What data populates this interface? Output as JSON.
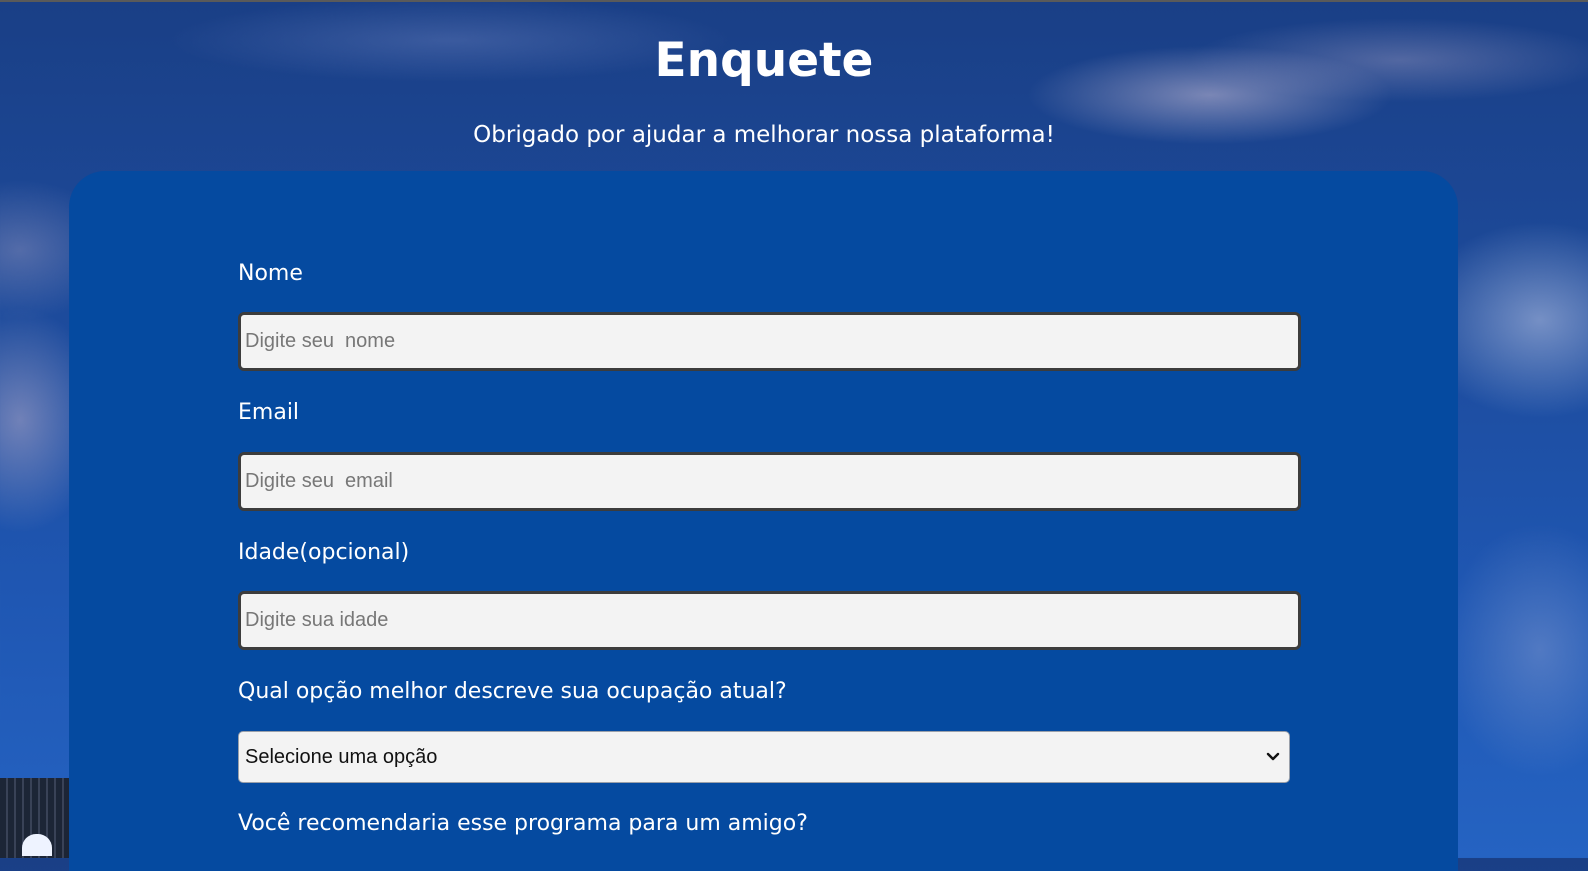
{
  "header": {
    "title": "Enquete",
    "subtitle": "Obrigado por ajudar a melhorar nossa plataforma!"
  },
  "form": {
    "name": {
      "label": "Nome",
      "placeholder": "Digite seu  nome",
      "value": ""
    },
    "email": {
      "label": "Email",
      "placeholder": "Digite seu  email",
      "value": ""
    },
    "age": {
      "label": "Idade(opcional)",
      "placeholder": "Digite sua idade",
      "value": ""
    },
    "occupation": {
      "label": "Qual opção melhor descreve sua ocupação atual?",
      "selected": "Selecione uma opção",
      "icon": "chevron-down-icon"
    },
    "recommend": {
      "label": "Você recomendaria esse programa para um amigo?"
    }
  },
  "colors": {
    "card_background": "#054aa0",
    "input_background": "#f3f3f3",
    "text": "#ffffff"
  }
}
